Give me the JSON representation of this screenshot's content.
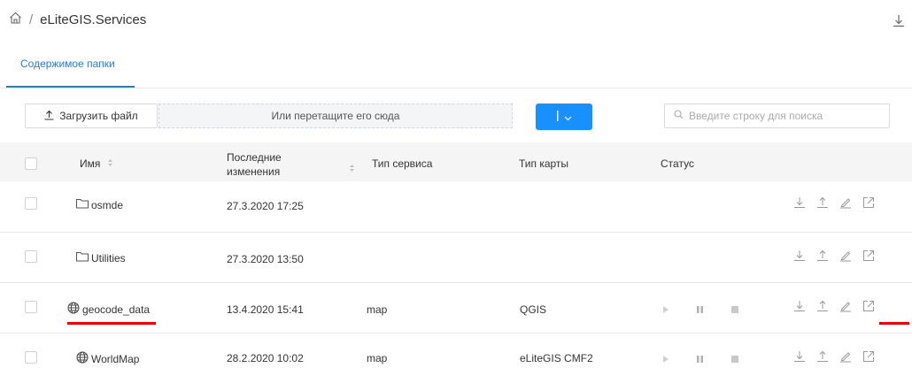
{
  "breadcrumb": {
    "root_icon": "home-icon",
    "separator": "/",
    "current": "eLiteGIS.Services"
  },
  "tabs": [
    {
      "label": "Содержимое папки",
      "active": true
    }
  ],
  "toolbar": {
    "upload_label": "Загрузить файл",
    "drop_text": "Или перетащите его сюда",
    "search_placeholder": "Введите строку для поиска"
  },
  "columns": {
    "name": "Имя",
    "modified": "Последние\nизменения",
    "service_type": "Тип сервиса",
    "map_type": "Тип карты",
    "status": "Статус"
  },
  "rows": [
    {
      "icon": "folder-icon",
      "name": "osmde",
      "modified": "27.3.2020 17:25",
      "service_type": "",
      "map_type": ""
    },
    {
      "icon": "folder-icon",
      "name": "Utilities",
      "modified": "27.3.2020 13:50",
      "service_type": "",
      "map_type": ""
    },
    {
      "icon": "globe-icon",
      "name": "geocode_data",
      "modified": "13.4.2020 15:41",
      "service_type": "map",
      "map_type": "QGIS"
    },
    {
      "icon": "globe-icon",
      "name": "WorldMap",
      "modified": "28.2.2020 10:02",
      "service_type": "map",
      "map_type": "eLiteGIS CMF2"
    }
  ],
  "colors": {
    "accent": "#1890ff",
    "highlight": "#e00000"
  }
}
